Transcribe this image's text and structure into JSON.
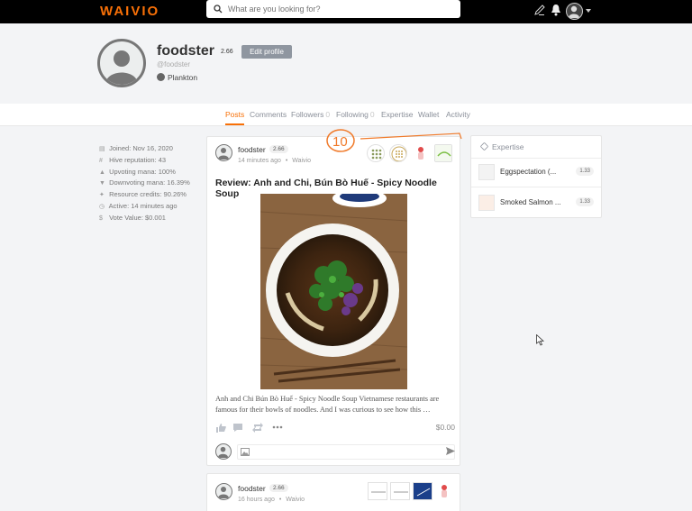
{
  "topbar": {
    "logo": "WAIVIO",
    "search_placeholder": "What are you looking for?",
    "icons": [
      "edit-icon",
      "bell-icon",
      "user-avatar-icon",
      "caret-down-icon"
    ]
  },
  "profile": {
    "username": "foodster",
    "reputation": "2.66",
    "edit_label": "Edit profile",
    "handle": "@foodster",
    "rank": "Plankton"
  },
  "tabs": [
    {
      "label": "Posts",
      "count": ""
    },
    {
      "label": "Comments",
      "count": ""
    },
    {
      "label": "Followers",
      "count": "0"
    },
    {
      "label": "Following",
      "count": "0"
    },
    {
      "label": "Expertise",
      "count": ""
    },
    {
      "label": "Wallet",
      "count": ""
    },
    {
      "label": "Activity",
      "count": ""
    }
  ],
  "stats": [
    {
      "icon": "calendar-icon",
      "text": "Joined: Nov 16, 2020"
    },
    {
      "icon": "hash-icon",
      "text": "Hive reputation: 43"
    },
    {
      "icon": "thumbs-up-icon",
      "text": "Upvoting mana: 100%"
    },
    {
      "icon": "thumbs-down-icon",
      "text": "Downvoting mana: 16.39%"
    },
    {
      "icon": "bolt-icon",
      "text": "Resource credits: 90.26%"
    },
    {
      "icon": "clock-icon",
      "text": "Active: 14 minutes ago"
    },
    {
      "icon": "dollar-icon",
      "text": "Vote Value: $0.001"
    }
  ],
  "posts": [
    {
      "author": "foodster",
      "reputation": "2.66",
      "time": "14 minutes ago",
      "separator": "•",
      "app": "Waivio",
      "title": "Review: Anh and Chi, Bún Bò Huế - Spicy Noodle Soup",
      "excerpt": "Anh and Chi Bún Bò Huế - Spicy Noodle Soup Vietnamese restaurants are famous for their bowls of noodles. And I was curious to see how this …",
      "payout": "$0.00",
      "annotation": "10"
    },
    {
      "author": "foodster",
      "reputation": "2.66",
      "time": "16 hours ago",
      "separator": "•",
      "app": "Waivio"
    }
  ],
  "expertise": {
    "title": "Expertise",
    "items": [
      {
        "name": "Eggspectation (...",
        "score": "1.33"
      },
      {
        "name": "Smoked Salmon ...",
        "score": "1.33"
      }
    ]
  },
  "colors": {
    "accent": "#f87007",
    "topbar": "#000000",
    "background": "#f3f4f6"
  }
}
